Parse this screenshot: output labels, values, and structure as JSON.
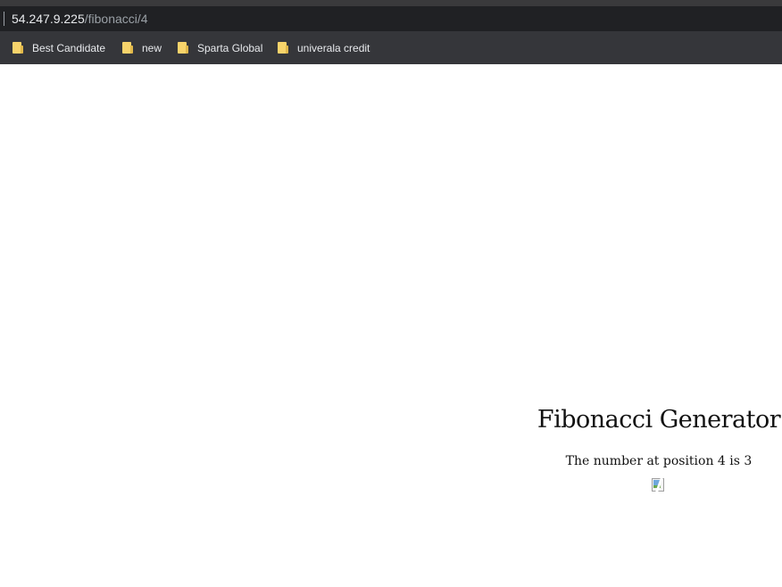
{
  "browser": {
    "url_host": "54.247.9.225",
    "url_path": "/fibonacci/4"
  },
  "bookmarks": [
    {
      "label": "Best Candidate",
      "icon": "folder-icon"
    },
    {
      "label": "new",
      "icon": "folder-icon"
    },
    {
      "label": "Sparta Global",
      "icon": "folder-icon"
    },
    {
      "label": "univerala credit",
      "icon": "folder-icon"
    }
  ],
  "page": {
    "title": "Fibonacci Generator",
    "result": "The number at position 4 is 3",
    "image_icon": "broken-image-icon"
  },
  "colors": {
    "browser_chrome": "#202124",
    "bookmarks_bar": "#35363a",
    "folder": "#f8d46b",
    "page_background": "#ffffff"
  }
}
